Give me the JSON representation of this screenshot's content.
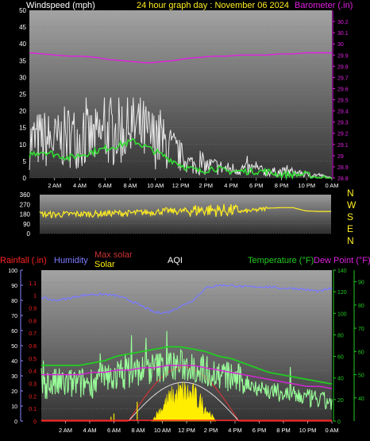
{
  "header": {
    "left_label": "Windspeed (mph)",
    "center_label": "24 hour graph day : November 06 2024",
    "right_label": "Barometer (.in)"
  },
  "colors": {
    "background": "#000000",
    "plot_top": "#9a9a9a",
    "plot_bottom": "#3a3a3a",
    "windspeed": "#e8e8e8",
    "wind_avg": "#33dd33",
    "barometer": "#e020e0",
    "direction": "#ffee22",
    "rainfall": "#ff2222",
    "humidity": "#7a7aff",
    "max_solar": "#cc3333",
    "solar": "#ffee00",
    "temperature": "#22cc22",
    "temperature_trace": "#99ff99",
    "dew_point": "#dd22dd",
    "axis_green": "#22cc22",
    "axis_blue": "#8888ff"
  },
  "x_ticks": [
    "2 AM",
    "4 AM",
    "6 AM",
    "8 AM",
    "10 AM",
    "12 PM",
    "2 PM",
    "4 PM",
    "6 PM",
    "8 PM",
    "10 PM",
    "0 AM"
  ],
  "compass": [
    "N",
    "W",
    "S",
    "E",
    "N"
  ],
  "legend": {
    "rainfall": "Rainfall (.in)",
    "humidity": "Humidity",
    "max_solar": "Max solar",
    "solar": "Solar",
    "aqi": "AQI",
    "temperature": "Temperature (°F)",
    "dew_point": "Dew Point (°F)"
  },
  "chart_data": [
    {
      "type": "line",
      "panel": "wind-barometer",
      "title": "24 hour graph day : November 06 2024",
      "x": [
        "0 AM",
        "2 AM",
        "4 AM",
        "6 AM",
        "8 AM",
        "10 AM",
        "12 PM",
        "2 PM",
        "4 PM",
        "6 PM",
        "8 PM",
        "10 PM",
        "0 AM"
      ],
      "y_left": {
        "label": "Windspeed (mph)",
        "ylim": [
          0,
          50
        ],
        "ticks": [
          0,
          5,
          10,
          15,
          20,
          25,
          30,
          35,
          40,
          45,
          50
        ]
      },
      "y_right": {
        "label": "Barometer (.in)",
        "ylim": [
          28.8,
          30.3
        ],
        "ticks": [
          "28.8",
          "28.9",
          "29",
          "29.1",
          "29.2",
          "29.3",
          "29.4",
          "29.5",
          "29.6",
          "29.7",
          "29.8",
          "29.9",
          "30",
          "30.1",
          "30.2"
        ]
      },
      "series": [
        {
          "name": "Windspeed (mph)",
          "axis": "left",
          "values": [
            12,
            13,
            12,
            14,
            13,
            13,
            15,
            16,
            17,
            14,
            12,
            9,
            5,
            4,
            4,
            3,
            3,
            3,
            2,
            2,
            2,
            1,
            1,
            0
          ]
        },
        {
          "name": "Average windspeed",
          "axis": "left",
          "values": [
            7,
            8,
            7,
            6,
            7,
            8,
            9,
            10,
            11,
            9,
            7,
            5,
            3,
            2,
            3,
            2,
            2,
            2,
            2,
            1,
            1,
            1,
            0,
            0
          ]
        },
        {
          "name": "Barometer (.in)",
          "axis": "right",
          "values": [
            29.92,
            29.91,
            29.9,
            29.89,
            29.89,
            29.88,
            29.86,
            29.85,
            29.84,
            29.83,
            29.84,
            29.85,
            29.87,
            29.88,
            29.89,
            29.89,
            29.9,
            29.9,
            29.9,
            29.91,
            29.91,
            29.92,
            29.92,
            29.92
          ]
        }
      ]
    },
    {
      "type": "line",
      "panel": "wind-direction",
      "ylim": [
        0,
        360
      ],
      "y_ticks": [
        0,
        90,
        180,
        270,
        360
      ],
      "series": [
        {
          "name": "Wind direction",
          "values": [
            180,
            175,
            178,
            182,
            180,
            185,
            190,
            188,
            195,
            200,
            210,
            205,
            215,
            220,
            215,
            215,
            205,
            215,
            235,
            240,
            240,
            210,
            205,
            205
          ]
        }
      ]
    },
    {
      "type": "line",
      "panel": "temperature-humidity-solar",
      "y_rain": {
        "label": "Rainfall (.in)",
        "ylim": [
          0,
          1.2
        ],
        "ticks": [
          "0",
          "0.1",
          "0.2",
          "0.3",
          "0.4",
          "0.5",
          "0.6",
          "0.7",
          "0.8",
          "0.9",
          "1",
          "1.1"
        ]
      },
      "y_humidity": {
        "label": "Humidity",
        "ylim": [
          0,
          100
        ],
        "ticks": [
          0,
          10,
          20,
          30,
          40,
          50,
          60,
          70,
          80,
          90,
          100
        ]
      },
      "y_solar": {
        "ylim": [
          0,
          140
        ],
        "ticks": [
          0,
          20,
          40,
          60,
          80,
          100,
          120,
          140
        ]
      },
      "y_temp": {
        "label": "Temperature (°F)",
        "ylim": [
          30,
          95
        ],
        "ticks": [
          40,
          50,
          60,
          70,
          80,
          90
        ]
      },
      "series": [
        {
          "name": "Humidity",
          "axis": "humidity",
          "values": [
            82,
            80,
            81,
            83,
            84,
            84,
            83,
            80,
            76,
            72,
            72,
            76,
            80,
            88,
            90,
            90,
            89,
            89,
            89,
            88,
            88,
            87,
            86,
            88
          ]
        },
        {
          "name": "Max solar",
          "axis": "solar",
          "values": [
            0,
            0,
            0,
            0,
            0,
            0,
            0,
            0,
            20,
            45,
            65,
            70,
            60,
            40,
            10,
            0,
            0,
            0,
            0,
            0,
            0,
            0,
            0,
            0
          ]
        },
        {
          "name": "Solar",
          "axis": "solar",
          "values": [
            0,
            0,
            0,
            0,
            0,
            0,
            0,
            0,
            10,
            25,
            45,
            50,
            35,
            15,
            3,
            0,
            0,
            0,
            0,
            0,
            0,
            0,
            0,
            0
          ]
        },
        {
          "name": "Temperature (°F)",
          "axis": "temp",
          "values": [
            54,
            54,
            54,
            54,
            55,
            56,
            58,
            59,
            60,
            61,
            62,
            62,
            61,
            60,
            58,
            57,
            55,
            53,
            51,
            50,
            49,
            48,
            47,
            46
          ]
        },
        {
          "name": "Dew Point (°F)",
          "axis": "temp",
          "values": [
            50,
            50,
            50,
            50,
            51,
            51,
            52,
            52,
            53,
            53,
            54,
            54,
            54,
            53,
            52,
            51,
            50,
            49,
            48,
            47,
            46,
            45,
            45,
            44
          ]
        },
        {
          "name": "Rainfall (.in)",
          "axis": "rain",
          "values": [
            0,
            0,
            0,
            0,
            0,
            0,
            0,
            0,
            0,
            0,
            0,
            0,
            0,
            0,
            0,
            0,
            0,
            0,
            0,
            0,
            0,
            0,
            0,
            0
          ]
        }
      ]
    }
  ]
}
